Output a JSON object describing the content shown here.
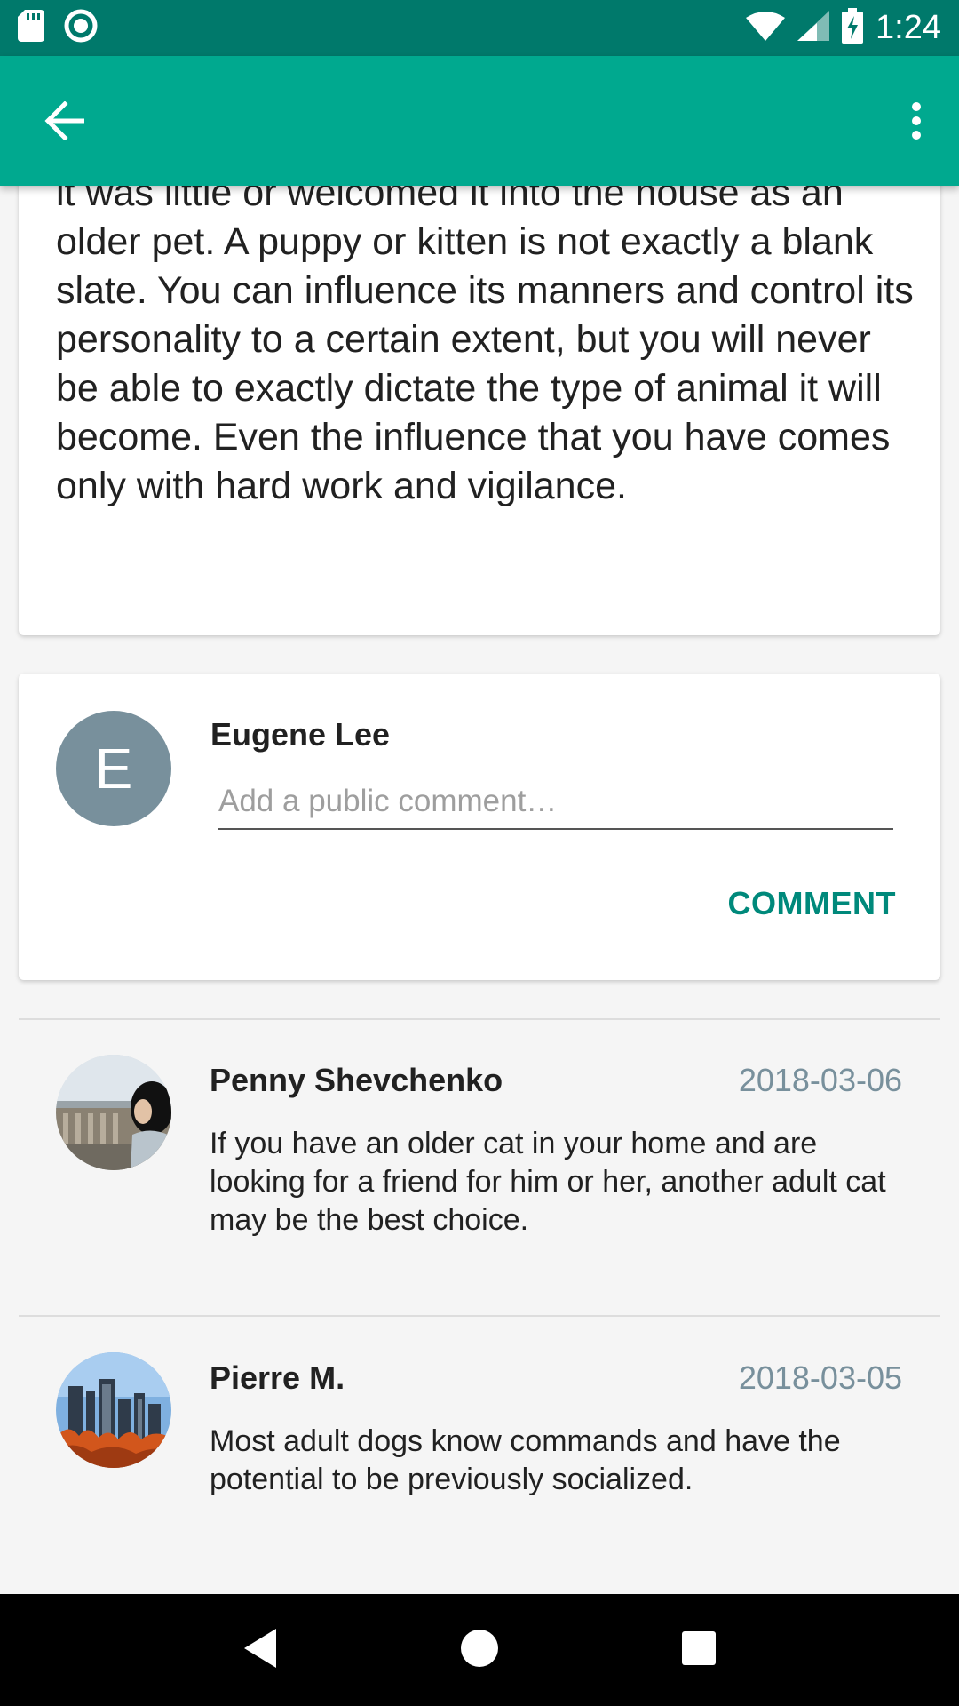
{
  "status_bar": {
    "time": "1:24",
    "icons": [
      "sd-card-icon",
      "sync-circle-icon",
      "wifi-icon",
      "signal-icon",
      "battery-charging-icon"
    ]
  },
  "app_bar": {
    "back_icon": "arrow-back-icon",
    "menu_icon": "more-vert-icon",
    "color": "#00a98f"
  },
  "article": {
    "body": "it was little or welcomed it into the house as an older pet. A puppy or kitten is not exactly a blank slate. You can influence its manners and control its personality to a certain extent, but you will never be able to exactly dictate the type of animal it will become. Even the influence that you have comes only with hard work and vigilance."
  },
  "composer": {
    "avatar_letter": "E",
    "user_name": "Eugene Lee",
    "placeholder": "Add a public comment…",
    "value": "",
    "button_label": "COMMENT",
    "accent": "#00897b"
  },
  "comments": [
    {
      "author": "Penny Shevchenko",
      "date": "2018-03-06",
      "body": "If you have an older cat in your home and are looking for a friend for him or her, another adult cat may be the best choice.",
      "avatar": "person-photo"
    },
    {
      "author": "Pierre M.",
      "date": "2018-03-05",
      "body": "Most adult dogs know commands and have the potential to be previously socialized.",
      "avatar": "city-skyline-photo"
    }
  ],
  "nav_bar": {
    "icons": [
      "back-triangle-icon",
      "home-circle-icon",
      "recents-square-icon"
    ]
  }
}
